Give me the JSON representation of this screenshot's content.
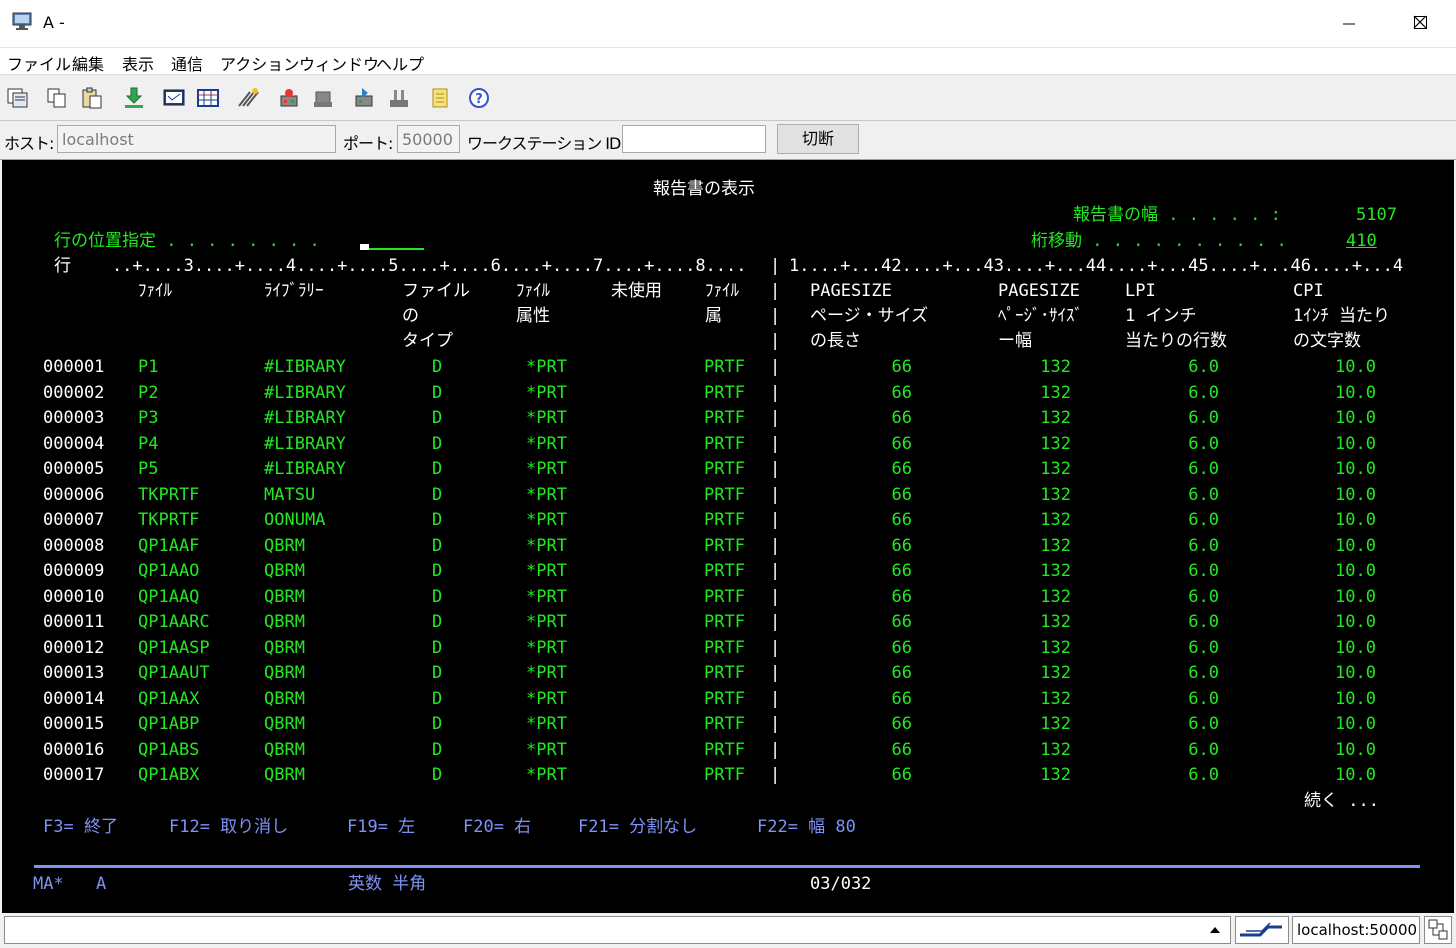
{
  "window": {
    "title": "A -"
  },
  "menu": [
    "ファイル",
    "編集",
    "表示",
    "通信",
    "アクション",
    "ウィンドウ",
    "ヘルプ"
  ],
  "toolbar_icons": [
    "copy-screen-icon",
    "copy-icon",
    "paste-icon",
    "download-icon",
    "screen-icon",
    "grid-icon",
    "macro-icon",
    "record-macro-icon",
    "stop-icon",
    "play-macro-icon",
    "printer-icon",
    "notes-icon",
    "help-icon"
  ],
  "hostbar": {
    "host_label": "ホスト:",
    "host_value": "localhost",
    "port_label": "ポート:",
    "port_value": "50000",
    "workstation_label": "ワークステーション ID:",
    "workstation_value": "",
    "disconnect_label": "切断"
  },
  "terminal": {
    "title": "報告書の表示",
    "report_width_label": "報告書の幅 . . . . . :",
    "report_width_value": "5107",
    "position_label": "行の位置指定 . . . . . . . .",
    "shift_label": "桁移動 . . . . . . . . . .",
    "shift_value": "410",
    "ruler_left": "行    ..+....3....+....4....+....5....+....6....+....7....+....8....",
    "ruler_right": "1....+...42....+...43....+...44....+...45....+...46....+...4",
    "left_headers": [
      [
        "ﾌｧｲﾙ",
        "ﾗｲﾌﾞﾗﾘｰ",
        "ファイル",
        "ﾌｧｲﾙ",
        "未使用",
        "ﾌｧｲﾙ"
      ],
      [
        "",
        "",
        "の",
        "属性",
        "",
        "属"
      ],
      [
        "",
        "",
        "タイプ",
        "",
        "",
        ""
      ]
    ],
    "right_headers": [
      [
        "PAGESIZE",
        "PAGESIZE",
        "LPI",
        "CPI"
      ],
      [
        "ページ・サイズ",
        "ﾍﾟｰｼﾞ･ｻｲｽﾞ",
        "1 インチ",
        "1ｲﾝﾁ 当たり"
      ],
      [
        "の長さ",
        "ー幅",
        "当たりの行数",
        "の文字数"
      ]
    ],
    "rows": [
      {
        "num": "000001",
        "file": "P1",
        "lib": "#LIBRARY",
        "type": "D",
        "attr": "*PRT",
        "ftype": "PRTF",
        "len": "66",
        "width": "132",
        "lpi": "6.0",
        "cpi": "10.0"
      },
      {
        "num": "000002",
        "file": "P2",
        "lib": "#LIBRARY",
        "type": "D",
        "attr": "*PRT",
        "ftype": "PRTF",
        "len": "66",
        "width": "132",
        "lpi": "6.0",
        "cpi": "10.0"
      },
      {
        "num": "000003",
        "file": "P3",
        "lib": "#LIBRARY",
        "type": "D",
        "attr": "*PRT",
        "ftype": "PRTF",
        "len": "66",
        "width": "132",
        "lpi": "6.0",
        "cpi": "10.0"
      },
      {
        "num": "000004",
        "file": "P4",
        "lib": "#LIBRARY",
        "type": "D",
        "attr": "*PRT",
        "ftype": "PRTF",
        "len": "66",
        "width": "132",
        "lpi": "6.0",
        "cpi": "10.0"
      },
      {
        "num": "000005",
        "file": "P5",
        "lib": "#LIBRARY",
        "type": "D",
        "attr": "*PRT",
        "ftype": "PRTF",
        "len": "66",
        "width": "132",
        "lpi": "6.0",
        "cpi": "10.0"
      },
      {
        "num": "000006",
        "file": "TKPRTF",
        "lib": "MATSU",
        "type": "D",
        "attr": "*PRT",
        "ftype": "PRTF",
        "len": "66",
        "width": "132",
        "lpi": "6.0",
        "cpi": "10.0"
      },
      {
        "num": "000007",
        "file": "TKPRTF",
        "lib": "OONUMA",
        "type": "D",
        "attr": "*PRT",
        "ftype": "PRTF",
        "len": "66",
        "width": "132",
        "lpi": "6.0",
        "cpi": "10.0"
      },
      {
        "num": "000008",
        "file": "QP1AAF",
        "lib": "QBRM",
        "type": "D",
        "attr": "*PRT",
        "ftype": "PRTF",
        "len": "66",
        "width": "132",
        "lpi": "6.0",
        "cpi": "10.0"
      },
      {
        "num": "000009",
        "file": "QP1AAO",
        "lib": "QBRM",
        "type": "D",
        "attr": "*PRT",
        "ftype": "PRTF",
        "len": "66",
        "width": "132",
        "lpi": "6.0",
        "cpi": "10.0"
      },
      {
        "num": "000010",
        "file": "QP1AAQ",
        "lib": "QBRM",
        "type": "D",
        "attr": "*PRT",
        "ftype": "PRTF",
        "len": "66",
        "width": "132",
        "lpi": "6.0",
        "cpi": "10.0"
      },
      {
        "num": "000011",
        "file": "QP1AARC",
        "lib": "QBRM",
        "type": "D",
        "attr": "*PRT",
        "ftype": "PRTF",
        "len": "66",
        "width": "132",
        "lpi": "6.0",
        "cpi": "10.0"
      },
      {
        "num": "000012",
        "file": "QP1AASP",
        "lib": "QBRM",
        "type": "D",
        "attr": "*PRT",
        "ftype": "PRTF",
        "len": "66",
        "width": "132",
        "lpi": "6.0",
        "cpi": "10.0"
      },
      {
        "num": "000013",
        "file": "QP1AAUT",
        "lib": "QBRM",
        "type": "D",
        "attr": "*PRT",
        "ftype": "PRTF",
        "len": "66",
        "width": "132",
        "lpi": "6.0",
        "cpi": "10.0"
      },
      {
        "num": "000014",
        "file": "QP1AAX",
        "lib": "QBRM",
        "type": "D",
        "attr": "*PRT",
        "ftype": "PRTF",
        "len": "66",
        "width": "132",
        "lpi": "6.0",
        "cpi": "10.0"
      },
      {
        "num": "000015",
        "file": "QP1ABP",
        "lib": "QBRM",
        "type": "D",
        "attr": "*PRT",
        "ftype": "PRTF",
        "len": "66",
        "width": "132",
        "lpi": "6.0",
        "cpi": "10.0"
      },
      {
        "num": "000016",
        "file": "QP1ABS",
        "lib": "QBRM",
        "type": "D",
        "attr": "*PRT",
        "ftype": "PRTF",
        "len": "66",
        "width": "132",
        "lpi": "6.0",
        "cpi": "10.0"
      },
      {
        "num": "000017",
        "file": "QP1ABX",
        "lib": "QBRM",
        "type": "D",
        "attr": "*PRT",
        "ftype": "PRTF",
        "len": "66",
        "width": "132",
        "lpi": "6.0",
        "cpi": "10.0"
      }
    ],
    "more_text": "続く ...",
    "function_keys": [
      "F3= 終了",
      "F12= 取り消し",
      "F19= 左",
      "F20= 右",
      "F21= 分割なし",
      "F22= 幅 80"
    ],
    "oia": {
      "session": "MA*",
      "mode": "A",
      "input_mode": "英数 半角",
      "cursor_pos": "03/032"
    }
  },
  "statusbar": {
    "connection": "localhost:50000"
  },
  "colors": {
    "field_text": "#22e822",
    "label_text": "#ffffff",
    "fkey_text": "#7e93f4",
    "screen_bg": "#000000"
  }
}
